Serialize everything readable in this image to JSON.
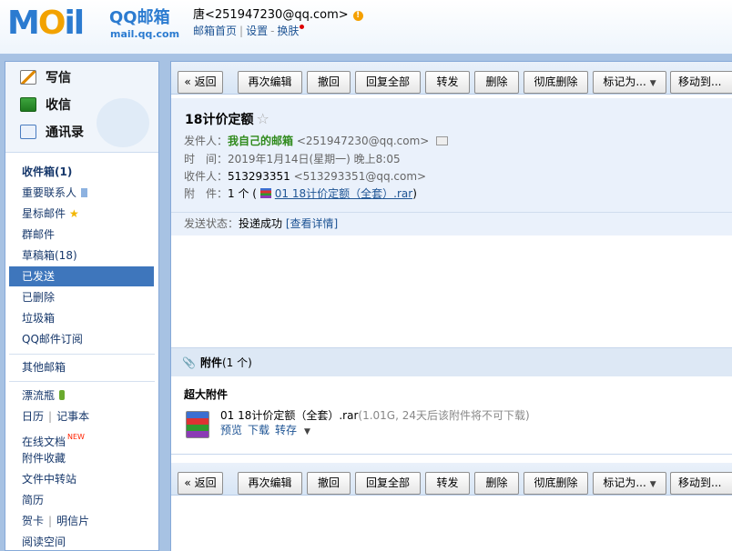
{
  "header": {
    "logo_text_a": "M",
    "logo_text_b": "O",
    "logo_text_c": "il",
    "brand": "QQ邮箱",
    "brand_url": "mail.qq.com",
    "user": "唐<251947230@qq.com>",
    "warn_symbol": "!",
    "links": [
      "邮箱首页",
      "设置",
      "换肤"
    ]
  },
  "sidebar": {
    "write": "写信",
    "receive": "收信",
    "contacts": "通讯录",
    "folders": [
      {
        "label": "收件箱(1)"
      },
      {
        "label": "重要联系人"
      },
      {
        "label": "星标邮件",
        "icon": "star-icon"
      },
      {
        "label": "群邮件"
      },
      {
        "label": "草稿箱(18)"
      },
      {
        "label": "已发送",
        "selected": true
      },
      {
        "label": "已删除"
      },
      {
        "label": "垃圾箱"
      },
      {
        "label": "QQ邮件订阅"
      }
    ],
    "other_mailbox": "其他邮箱",
    "apps": {
      "drift_bottle": "漂流瓶",
      "calendar": "日历",
      "notepad": "记事本",
      "online_docs": "在线文档",
      "new_tag": "NEW",
      "attachments_saved": "附件收藏",
      "file_transfer": "文件中转站",
      "resume": "简历",
      "cards": "贺卡",
      "postcards": "明信片",
      "reading_space": "阅读空间"
    }
  },
  "toolbar": {
    "back": "« 返回",
    "reedit": "再次编辑",
    "recall": "撤回",
    "reply_all": "回复全部",
    "forward": "转发",
    "delete": "删除",
    "delete_permanently": "彻底删除",
    "mark_as": "标记为...",
    "move_to": "移动到..."
  },
  "mail": {
    "subject": "18计价定额",
    "star_symbol": "☆",
    "from_label": "发件人：",
    "from_name": "我自己的邮箱",
    "from_addr": "<251947230@qq.com>",
    "time_label": "时　间：",
    "time_value": "2019年1月14日(星期一) 晚上8:05",
    "to_label": "收件人：",
    "to_name": "513293351",
    "to_addr": "<513293351@qq.com>",
    "att_label": "附　件：",
    "att_count": "1 个 (",
    "att_link": "01 18计价定额（全套）.rar",
    "att_close": ")",
    "status_label": "发送状态：",
    "status_value": "投递成功",
    "status_link": "[查看详情]"
  },
  "attachments": {
    "title": "附件",
    "count": "(1 个)",
    "big_title": "超大附件",
    "file_name": "01 18计价定额（全套）.rar",
    "file_meta": "(1.01G, 24天后该附件将不可下载)",
    "preview": "预览",
    "download": "下载",
    "save": "转存"
  }
}
